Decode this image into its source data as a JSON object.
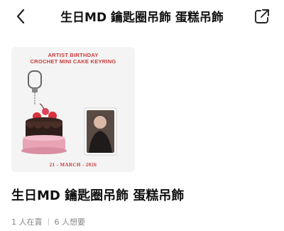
{
  "header": {
    "title": "生日MD 鑰匙圈吊飾 蛋糕吊飾",
    "back_icon": "chevron-left-icon",
    "share_icon": "share-arrow-icon"
  },
  "product_image": {
    "title_line1": "ARTIST BIRTHDAY",
    "title_line2": "CROCHET MINI CAKE KEYRING",
    "date": "21 - MARCH - 2026",
    "accent_color": "#c93a3a"
  },
  "product": {
    "name": "生日MD 鑰匙圈吊飾 蛋糕吊飾",
    "selling": "1 人在賣",
    "wanting": "6 人想要"
  }
}
